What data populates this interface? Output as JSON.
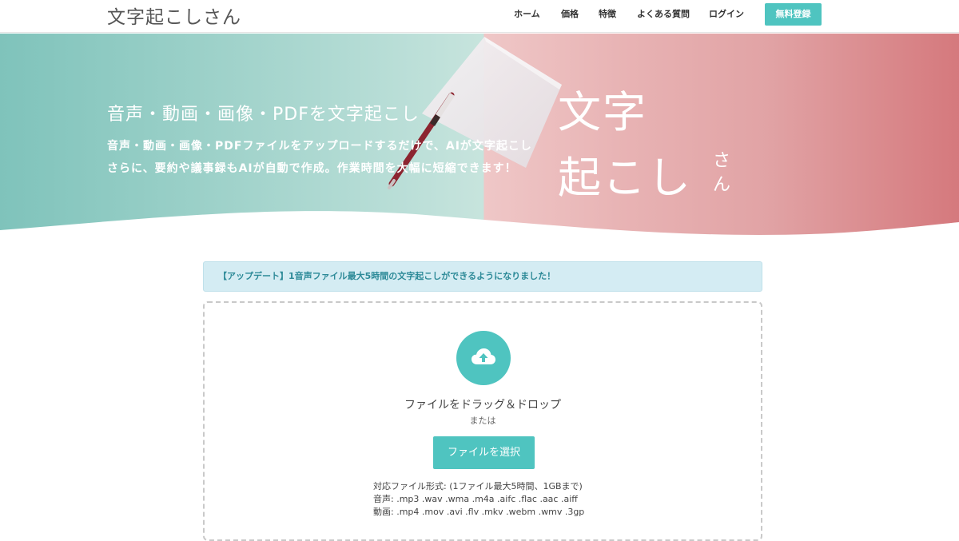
{
  "header": {
    "logo": "文字起こしさん",
    "nav": [
      "ホーム",
      "価格",
      "特徴",
      "よくある質問",
      "ログイン"
    ],
    "signup_button": "無料登録"
  },
  "hero": {
    "title": "音声・動画・画像・PDFを文字起こし",
    "line1": "音声・動画・画像・PDFファイルをアップロードするだけで、AIが文字起こし",
    "line2": "さらに、要約や議事録もAIが自動で作成。作業時間を大幅に短縮できます！",
    "brand_line1": "文字",
    "brand_line2": "起こし",
    "brand_small1": "さ",
    "brand_small2": "ん"
  },
  "alert": {
    "text": "【アップデート】1音声ファイル最大5時間の文字起こしができるようになりました！"
  },
  "dropzone": {
    "drop_text": "ファイルをドラッグ＆ドロップ",
    "or_text": "または",
    "select_button": "ファイルを選択",
    "formats_title": "対応ファイル形式: (1ファイル最大5時間、1GBまで)",
    "audio_formats": "音声: .mp3 .wav .wma .m4a .aifc .flac .aac .aiff",
    "video_formats": "動画: .mp4 .mov .avi .flv .mkv .webm .wmv .3gp"
  },
  "colors": {
    "accent": "#4fc4c0",
    "alert_bg": "#d4ecf3",
    "alert_text": "#2d8a98",
    "hero_left": "#7fc3bb",
    "hero_right": "#d5797d"
  },
  "icons": {
    "upload": "cloud-upload-icon"
  }
}
